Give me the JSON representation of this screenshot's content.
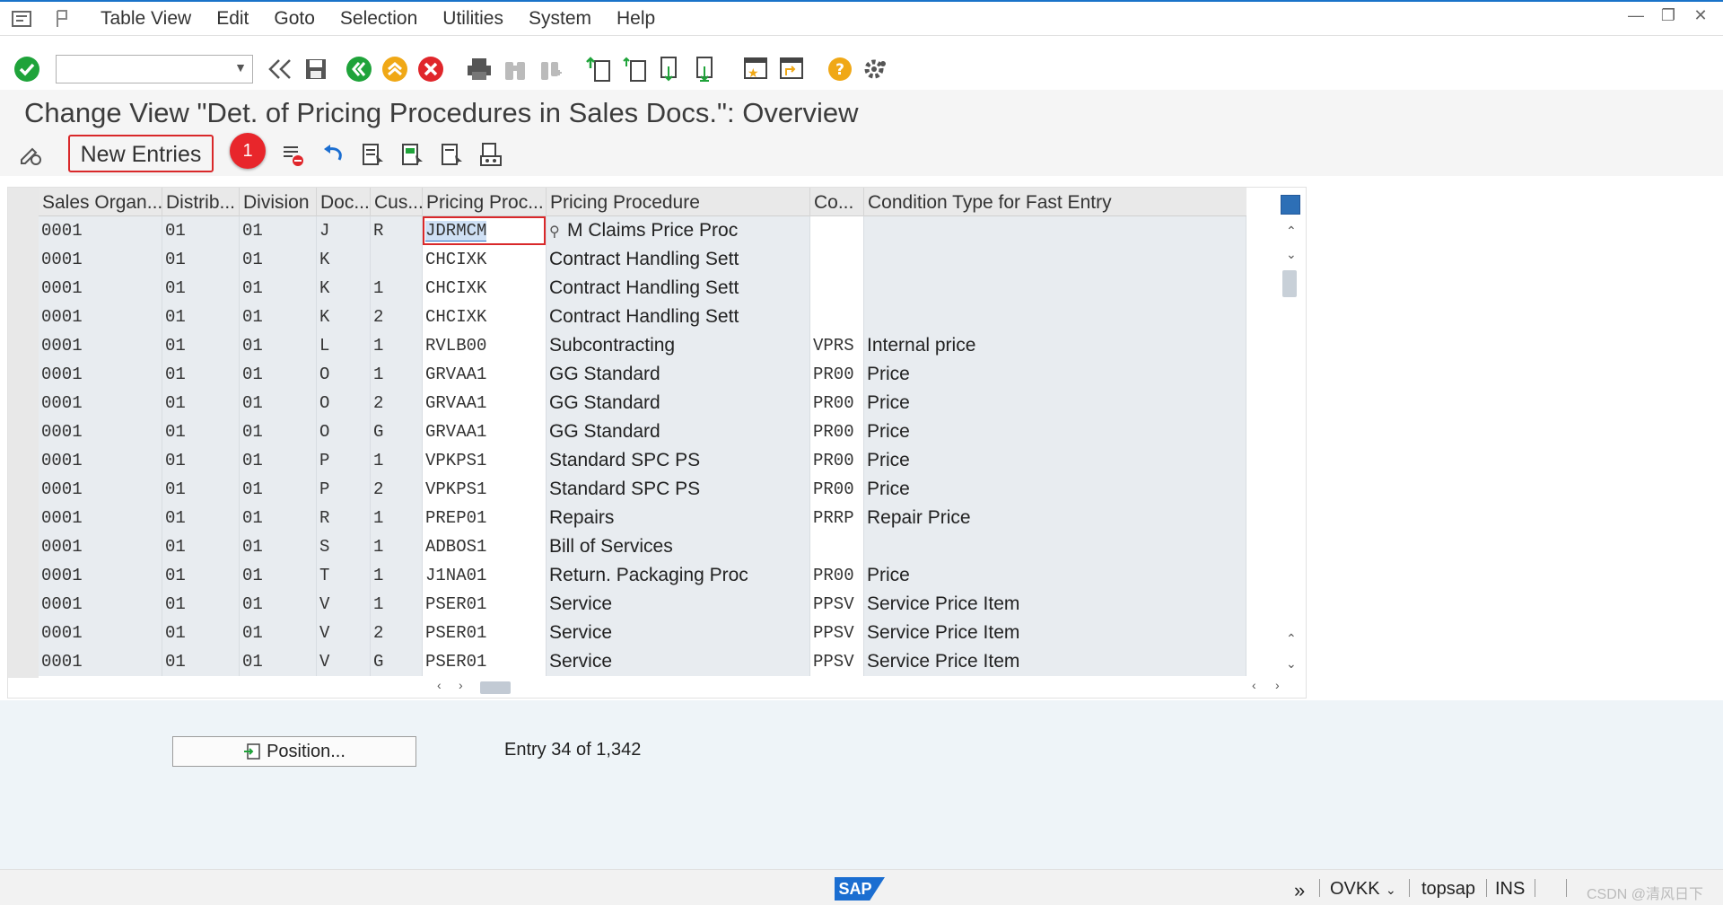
{
  "menu": {
    "items": [
      "Table View",
      "Edit",
      "Goto",
      "Selection",
      "Utilities",
      "System",
      "Help"
    ]
  },
  "toolbar": {
    "command_value": ""
  },
  "page": {
    "title": "Change View \"Det. of Pricing Procedures in Sales Docs.\": Overview"
  },
  "app_toolbar": {
    "new_entries_label": "New Entries",
    "badge": "1"
  },
  "table": {
    "headers": [
      "Sales Organ...",
      "Distrib...",
      "Division",
      "Doc...",
      "Cus...",
      "Pricing Proc...",
      "Pricing Procedure",
      "Co...",
      "Condition Type for Fast Entry"
    ],
    "rows": [
      {
        "sorg": "0001",
        "dist": "01",
        "div": "01",
        "doc": "J",
        "cus": "R",
        "proc": "JDRMCM",
        "proc_text": "M Claims  Price Proc",
        "cond": "",
        "cond_text": ""
      },
      {
        "sorg": "0001",
        "dist": "01",
        "div": "01",
        "doc": "K",
        "cus": "",
        "proc": "CHCIXK",
        "proc_text": "Contract Handling Sett",
        "cond": "",
        "cond_text": ""
      },
      {
        "sorg": "0001",
        "dist": "01",
        "div": "01",
        "doc": "K",
        "cus": "1",
        "proc": "CHCIXK",
        "proc_text": "Contract Handling Sett",
        "cond": "",
        "cond_text": ""
      },
      {
        "sorg": "0001",
        "dist": "01",
        "div": "01",
        "doc": "K",
        "cus": "2",
        "proc": "CHCIXK",
        "proc_text": "Contract Handling Sett",
        "cond": "",
        "cond_text": ""
      },
      {
        "sorg": "0001",
        "dist": "01",
        "div": "01",
        "doc": "L",
        "cus": "1",
        "proc": "RVLB00",
        "proc_text": "Subcontracting",
        "cond": "VPRS",
        "cond_text": "Internal price"
      },
      {
        "sorg": "0001",
        "dist": "01",
        "div": "01",
        "doc": "O",
        "cus": "1",
        "proc": "GRVAA1",
        "proc_text": "GG Standard",
        "cond": "PR00",
        "cond_text": "Price"
      },
      {
        "sorg": "0001",
        "dist": "01",
        "div": "01",
        "doc": "O",
        "cus": "2",
        "proc": "GRVAA1",
        "proc_text": "GG Standard",
        "cond": "PR00",
        "cond_text": "Price"
      },
      {
        "sorg": "0001",
        "dist": "01",
        "div": "01",
        "doc": "O",
        "cus": "G",
        "proc": "GRVAA1",
        "proc_text": "GG Standard",
        "cond": "PR00",
        "cond_text": "Price"
      },
      {
        "sorg": "0001",
        "dist": "01",
        "div": "01",
        "doc": "P",
        "cus": "1",
        "proc": "VPKPS1",
        "proc_text": "Standard SPC PS",
        "cond": "PR00",
        "cond_text": "Price"
      },
      {
        "sorg": "0001",
        "dist": "01",
        "div": "01",
        "doc": "P",
        "cus": "2",
        "proc": "VPKPS1",
        "proc_text": "Standard SPC PS",
        "cond": "PR00",
        "cond_text": "Price"
      },
      {
        "sorg": "0001",
        "dist": "01",
        "div": "01",
        "doc": "R",
        "cus": "1",
        "proc": "PREP01",
        "proc_text": "Repairs",
        "cond": "PRRP",
        "cond_text": "Repair Price"
      },
      {
        "sorg": "0001",
        "dist": "01",
        "div": "01",
        "doc": "S",
        "cus": "1",
        "proc": "ADBOS1",
        "proc_text": "Bill of Services",
        "cond": "",
        "cond_text": ""
      },
      {
        "sorg": "0001",
        "dist": "01",
        "div": "01",
        "doc": "T",
        "cus": "1",
        "proc": "J1NA01",
        "proc_text": "Return. Packaging Proc",
        "cond": "PR00",
        "cond_text": "Price"
      },
      {
        "sorg": "0001",
        "dist": "01",
        "div": "01",
        "doc": "V",
        "cus": "1",
        "proc": "PSER01",
        "proc_text": "Service",
        "cond": "PPSV",
        "cond_text": "Service Price Item"
      },
      {
        "sorg": "0001",
        "dist": "01",
        "div": "01",
        "doc": "V",
        "cus": "2",
        "proc": "PSER01",
        "proc_text": "Service",
        "cond": "PPSV",
        "cond_text": "Service Price Item"
      },
      {
        "sorg": "0001",
        "dist": "01",
        "div": "01",
        "doc": "V",
        "cus": "G",
        "proc": "PSER01",
        "proc_text": "Service",
        "cond": "PPSV",
        "cond_text": "Service Price Item"
      }
    ]
  },
  "footer": {
    "position_label": "Position...",
    "entry_info": "Entry 34 of 1,342"
  },
  "statusbar": {
    "logo": "SAP",
    "transaction": "OVKK",
    "server": "topsap",
    "mode": "INS",
    "watermark": "CSDN @清风日下"
  },
  "colors": {
    "accent": "#1a73c9",
    "highlight_red": "#d9282a",
    "ok_green": "#1fa33a",
    "cancel_red": "#e0262b",
    "help_orange": "#f0a816"
  }
}
